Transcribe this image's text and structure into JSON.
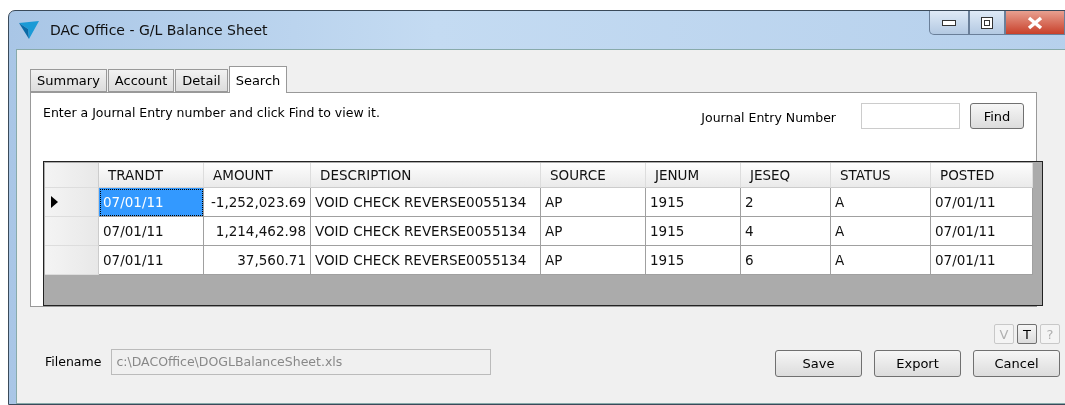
{
  "window": {
    "title": "DAC Office - G/L Balance Sheet"
  },
  "tabs": [
    {
      "label": "Summary",
      "selected": false
    },
    {
      "label": "Account",
      "selected": false
    },
    {
      "label": "Detail",
      "selected": false
    },
    {
      "label": "Search",
      "selected": true
    }
  ],
  "search": {
    "instruction": "Enter a Journal Entry number and click Find to view it.",
    "label": "Journal Entry Number",
    "button": "Find"
  },
  "table": {
    "columns": [
      "TRANDT",
      "AMOUNT",
      "DESCRIPTION",
      "SOURCE",
      "JENUM",
      "JESEQ",
      "STATUS",
      "POSTED"
    ],
    "rows": [
      {
        "selected": true,
        "cells": [
          "07/01/11",
          "-1,252,023.69",
          "VOID CHECK REVERSE0055134",
          "AP",
          "1915",
          "2",
          "A",
          "07/01/11"
        ]
      },
      {
        "selected": false,
        "cells": [
          "07/01/11",
          "1,214,462.98",
          "VOID CHECK REVERSE0055134",
          "AP",
          "1915",
          "4",
          "A",
          "07/01/11"
        ]
      },
      {
        "selected": false,
        "cells": [
          "07/01/11",
          "37,560.71",
          "VOID CHECK REVERSE0055134",
          "AP",
          "1915",
          "6",
          "A",
          "07/01/11"
        ]
      }
    ]
  },
  "small_buttons": [
    {
      "label": "V",
      "disabled": true
    },
    {
      "label": "T",
      "disabled": false
    },
    {
      "label": "?",
      "disabled": true
    }
  ],
  "filename": {
    "label": "Filename",
    "value": "c:\\DACOffice\\DOGLBalanceSheet.xls"
  },
  "buttons": [
    "Save",
    "Export",
    "Cancel"
  ]
}
